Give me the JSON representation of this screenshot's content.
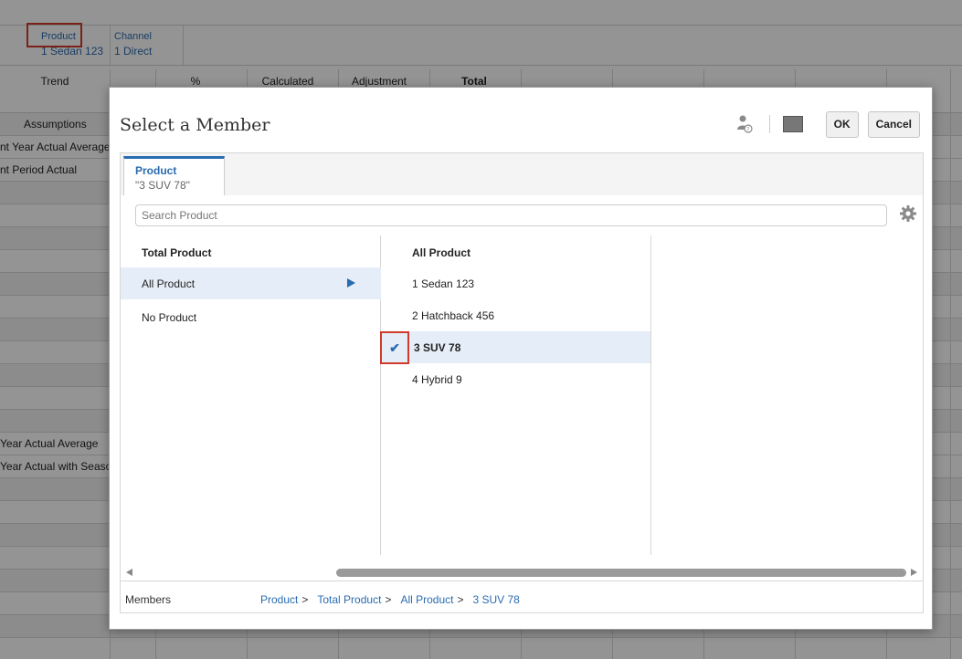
{
  "background": {
    "pov": [
      {
        "name": "Product",
        "value": "1 Sedan 123"
      },
      {
        "name": "Channel",
        "value": "1 Direct"
      }
    ],
    "headers": [
      "Trend",
      "%",
      "Calculated",
      "Adjustment",
      "Total"
    ],
    "assumptions_header": "Assumptions",
    "rows": [
      "nt Year Actual Average",
      "nt Period Actual",
      "Year Actual Average",
      "Year Actual with Seaso"
    ]
  },
  "dialog": {
    "title": "Select a Member",
    "ok_label": "OK",
    "cancel_label": "Cancel",
    "tab": {
      "name": "Product",
      "value": "\"3 SUV 78\""
    },
    "search_placeholder": "Search Product",
    "column1": {
      "header": "Total Product",
      "items": [
        "All Product",
        "No Product"
      ]
    },
    "column2": {
      "header": "All Product",
      "items": [
        "1 Sedan 123",
        "2 Hatchback 456",
        "3 SUV 78",
        "4 Hybrid 9"
      ]
    },
    "footer_label": "Members",
    "breadcrumbs": [
      "Product",
      "Total Product",
      "All Product",
      "3 SUV 78"
    ]
  },
  "colors": {
    "accent": "#2a6cb0",
    "highlight_border": "#d03a2a",
    "selected_row": "#e5eef8"
  }
}
